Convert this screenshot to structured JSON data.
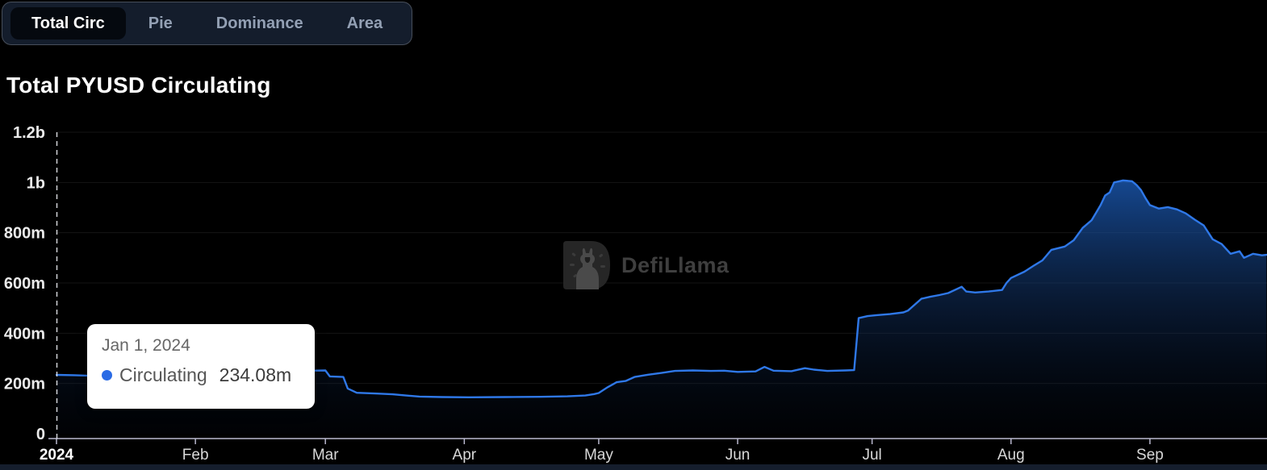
{
  "tabs": {
    "items": [
      {
        "label": "Total Circ",
        "active": true
      },
      {
        "label": "Pie",
        "active": false
      },
      {
        "label": "Dominance",
        "active": false
      },
      {
        "label": "Area",
        "active": false
      }
    ]
  },
  "header": {
    "title": "Total PYUSD Circulating"
  },
  "watermark": {
    "text": "DefiLlama"
  },
  "tooltip": {
    "date": "Jan 1, 2024",
    "series": "Circulating",
    "value": "234.08m"
  },
  "colors": {
    "background": "#000000",
    "tabbar_bg": "#141d2c",
    "active_tab_bg": "#05090f",
    "line": "#2f78e8",
    "area_top": "#2172e5",
    "axis": "#b9b8ce",
    "grid": "rgba(255,255,255,0.08)",
    "crosshair": "#e8eaee",
    "tooltip_dot": "#2a6be5"
  },
  "chart_data": {
    "type": "area",
    "title": "Total PYUSD Circulating",
    "values_in": "millions",
    "ylim": [
      0,
      1200
    ],
    "grid": true,
    "legend_position": "none",
    "crosshair_date": "2024-01-01",
    "y_ticks": [
      {
        "value": 0,
        "label": "0"
      },
      {
        "value": 200,
        "label": "200m"
      },
      {
        "value": 400,
        "label": "400m"
      },
      {
        "value": 600,
        "label": "600m"
      },
      {
        "value": 800,
        "label": "800m"
      },
      {
        "value": 1000,
        "label": "1b"
      },
      {
        "value": 1200,
        "label": "1.2b"
      }
    ],
    "x_ticks": [
      {
        "date": "2024-01-01",
        "label": "2024",
        "bold": true
      },
      {
        "date": "2024-02-01",
        "label": "Feb"
      },
      {
        "date": "2024-03-01",
        "label": "Mar"
      },
      {
        "date": "2024-04-01",
        "label": "Apr"
      },
      {
        "date": "2024-05-01",
        "label": "May"
      },
      {
        "date": "2024-06-01",
        "label": "Jun"
      },
      {
        "date": "2024-07-01",
        "label": "Jul"
      },
      {
        "date": "2024-08-01",
        "label": "Aug"
      },
      {
        "date": "2024-09-01",
        "label": "Sep"
      }
    ],
    "series": [
      {
        "name": "Circulating",
        "color": "#2172e5",
        "points": [
          [
            "2024-01-01",
            234.08
          ],
          [
            "2024-01-05",
            233
          ],
          [
            "2024-01-10",
            230
          ],
          [
            "2024-01-15",
            228
          ],
          [
            "2024-01-20",
            229
          ],
          [
            "2024-01-26",
            230
          ],
          [
            "2024-02-01",
            231
          ],
          [
            "2024-02-07",
            232
          ],
          [
            "2024-02-12",
            234
          ],
          [
            "2024-02-17",
            237
          ],
          [
            "2024-02-21",
            240
          ],
          [
            "2024-02-23",
            252
          ],
          [
            "2024-02-26",
            251
          ],
          [
            "2024-03-01",
            252
          ],
          [
            "2024-03-02",
            228
          ],
          [
            "2024-03-05",
            226
          ],
          [
            "2024-03-06",
            180
          ],
          [
            "2024-03-08",
            163
          ],
          [
            "2024-03-12",
            160
          ],
          [
            "2024-03-16",
            157
          ],
          [
            "2024-03-19",
            152
          ],
          [
            "2024-03-22",
            148
          ],
          [
            "2024-03-27",
            146
          ],
          [
            "2024-04-02",
            145
          ],
          [
            "2024-04-10",
            146
          ],
          [
            "2024-04-18",
            147
          ],
          [
            "2024-04-24",
            149
          ],
          [
            "2024-04-28",
            152
          ],
          [
            "2024-04-30",
            158
          ],
          [
            "2024-05-01",
            162
          ],
          [
            "2024-05-03",
            185
          ],
          [
            "2024-05-05",
            205
          ],
          [
            "2024-05-07",
            210
          ],
          [
            "2024-05-09",
            226
          ],
          [
            "2024-05-12",
            235
          ],
          [
            "2024-05-15",
            242
          ],
          [
            "2024-05-18",
            250
          ],
          [
            "2024-05-22",
            252
          ],
          [
            "2024-05-26",
            250
          ],
          [
            "2024-05-29",
            251
          ],
          [
            "2024-06-01",
            246
          ],
          [
            "2024-06-05",
            248
          ],
          [
            "2024-06-07",
            266
          ],
          [
            "2024-06-09",
            251
          ],
          [
            "2024-06-13",
            249
          ],
          [
            "2024-06-16",
            261
          ],
          [
            "2024-06-18",
            255
          ],
          [
            "2024-06-21",
            250
          ],
          [
            "2024-06-25",
            252
          ],
          [
            "2024-06-27",
            253
          ],
          [
            "2024-06-28",
            460
          ],
          [
            "2024-06-30",
            468
          ],
          [
            "2024-07-02",
            472
          ],
          [
            "2024-07-05",
            476
          ],
          [
            "2024-07-08",
            483
          ],
          [
            "2024-07-09",
            490
          ],
          [
            "2024-07-12",
            537
          ],
          [
            "2024-07-14",
            545
          ],
          [
            "2024-07-16",
            552
          ],
          [
            "2024-07-18",
            560
          ],
          [
            "2024-07-21",
            585
          ],
          [
            "2024-07-22",
            566
          ],
          [
            "2024-07-24",
            562
          ],
          [
            "2024-07-27",
            566
          ],
          [
            "2024-07-30",
            572
          ],
          [
            "2024-07-31",
            600
          ],
          [
            "2024-08-01",
            620
          ],
          [
            "2024-08-04",
            645
          ],
          [
            "2024-08-06",
            668
          ],
          [
            "2024-08-08",
            690
          ],
          [
            "2024-08-10",
            732
          ],
          [
            "2024-08-13",
            745
          ],
          [
            "2024-08-15",
            770
          ],
          [
            "2024-08-17",
            819
          ],
          [
            "2024-08-19",
            850
          ],
          [
            "2024-08-20",
            880
          ],
          [
            "2024-08-21",
            910
          ],
          [
            "2024-08-22",
            948
          ],
          [
            "2024-08-23",
            960
          ],
          [
            "2024-08-24",
            1000
          ],
          [
            "2024-08-26",
            1008
          ],
          [
            "2024-08-28",
            1005
          ],
          [
            "2024-08-29",
            990
          ],
          [
            "2024-08-30",
            970
          ],
          [
            "2024-08-31",
            938
          ],
          [
            "2024-09-01",
            910
          ],
          [
            "2024-09-03",
            896
          ],
          [
            "2024-09-05",
            902
          ],
          [
            "2024-09-07",
            893
          ],
          [
            "2024-09-09",
            877
          ],
          [
            "2024-09-11",
            852
          ],
          [
            "2024-09-13",
            829
          ],
          [
            "2024-09-15",
            774
          ],
          [
            "2024-09-17",
            755
          ],
          [
            "2024-09-19",
            716
          ],
          [
            "2024-09-21",
            726
          ],
          [
            "2024-09-22",
            700
          ],
          [
            "2024-09-24",
            716
          ],
          [
            "2024-09-26",
            710
          ],
          [
            "2024-09-27",
            712
          ]
        ]
      }
    ]
  }
}
